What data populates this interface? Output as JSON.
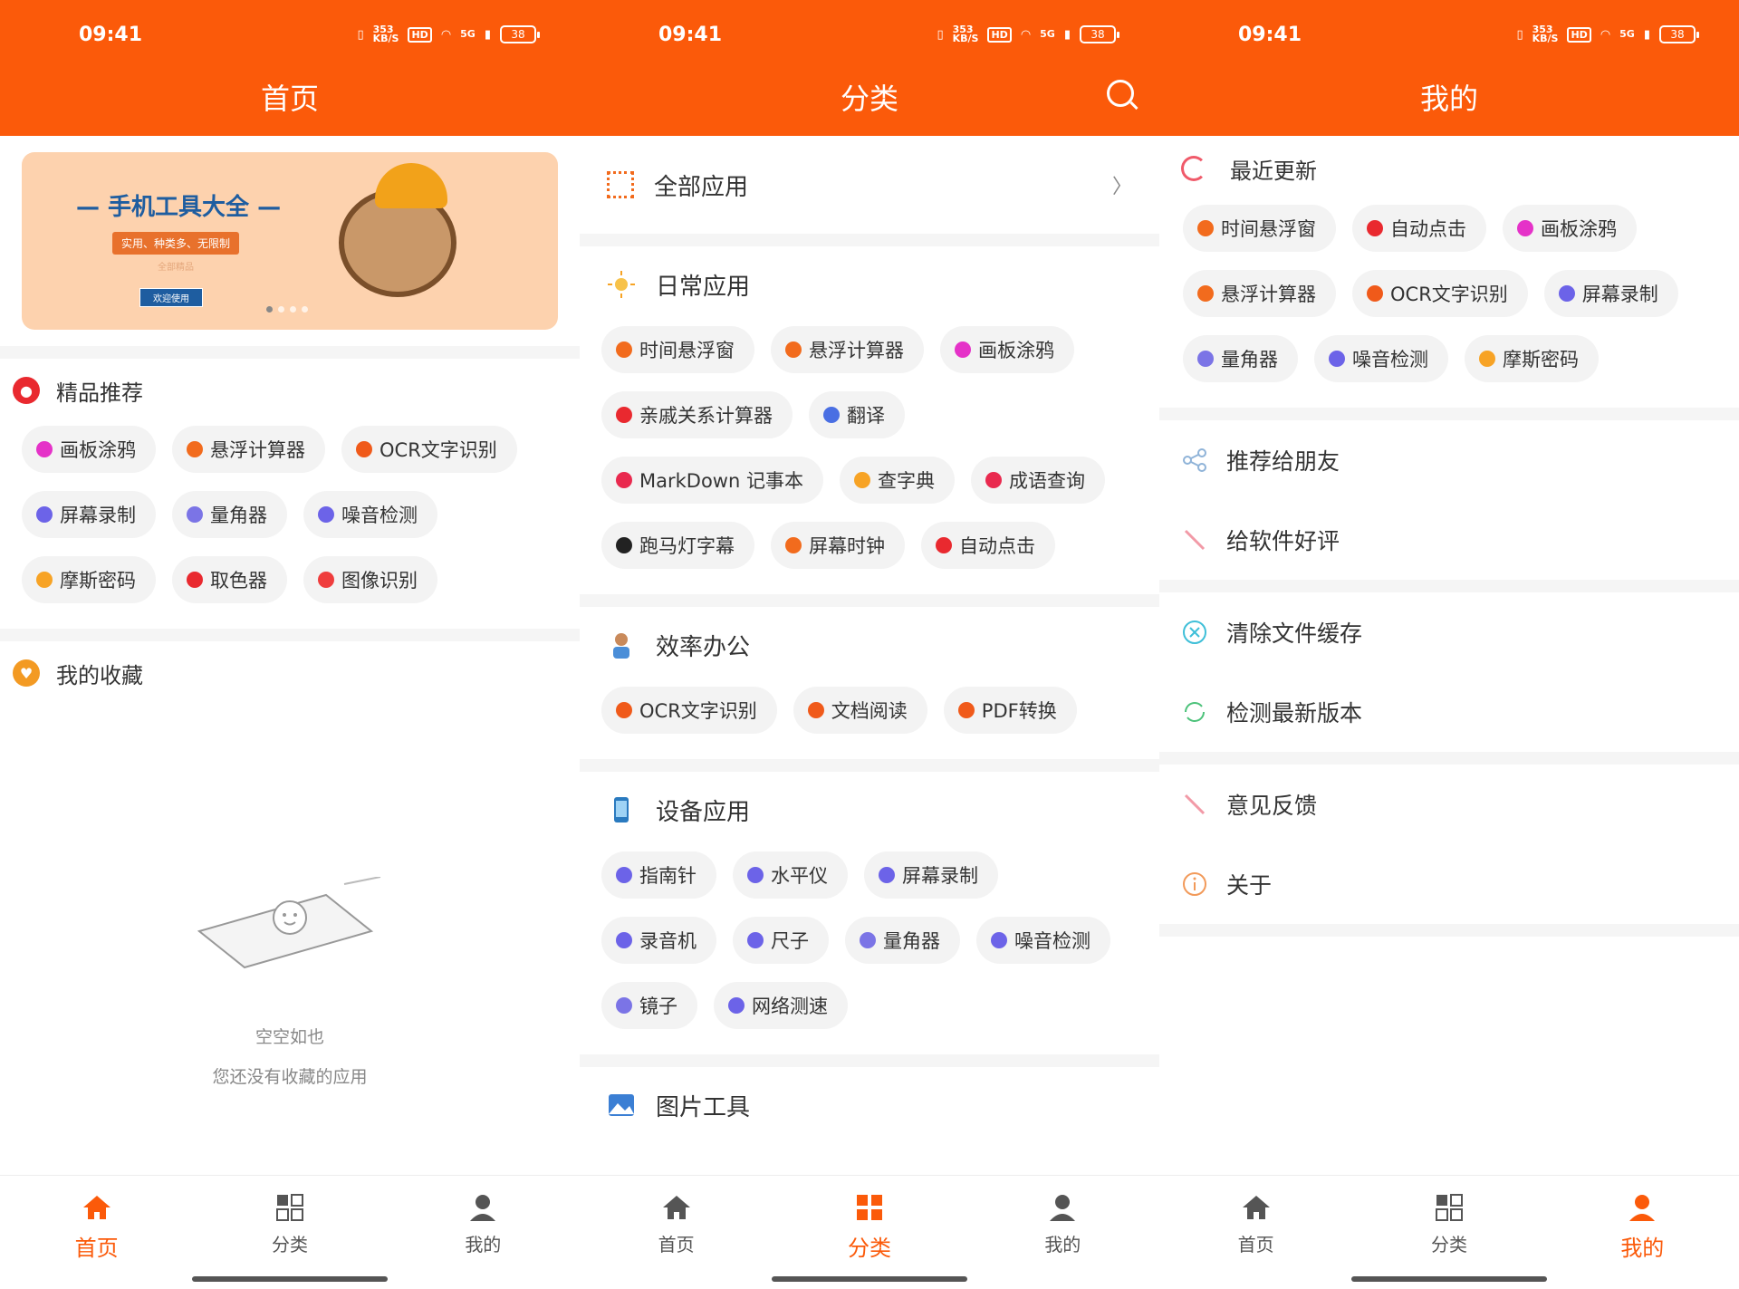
{
  "status": {
    "time": "09:41",
    "speed_top": "353",
    "speed_bottom": "KB/S",
    "hd": "HD",
    "net": "5G",
    "battery": "38"
  },
  "home": {
    "title": "首页",
    "banner": {
      "title": "— 手机工具大全 —",
      "slogan": "实用、种类多、无限制",
      "sub": "全部精品",
      "button": "欢迎使用"
    },
    "featured_title": "精品推荐",
    "featured": [
      {
        "label": "画板涂鸦",
        "color": "#e532c8"
      },
      {
        "label": "悬浮计算器",
        "color": "#f26b1d"
      },
      {
        "label": "OCR文字识别",
        "color": "#f05a1a"
      },
      {
        "label": "屏幕录制",
        "color": "#6c63e8"
      },
      {
        "label": "量角器",
        "color": "#7b74e6"
      },
      {
        "label": "噪音检测",
        "color": "#6c63e8"
      },
      {
        "label": "摩斯密码",
        "color": "#f7a325"
      },
      {
        "label": "取色器",
        "color": "#e9292f"
      },
      {
        "label": "图像识别",
        "color": "#ef3d3d"
      }
    ],
    "favorites_title": "我的收藏",
    "empty_title": "空空如也",
    "empty_desc": "您还没有收藏的应用"
  },
  "category": {
    "title": "分类",
    "all_apps": "全部应用",
    "chevron": "〉",
    "sections": [
      {
        "title": "日常应用",
        "items": [
          {
            "label": "时间悬浮窗",
            "color": "#f26b1d"
          },
          {
            "label": "悬浮计算器",
            "color": "#f26b1d"
          },
          {
            "label": "画板涂鸦",
            "color": "#e532c8"
          },
          {
            "label": "亲戚关系计算器",
            "color": "#e9292f"
          },
          {
            "label": "翻译",
            "color": "#4a6fe3"
          },
          {
            "label": "MarkDown 记事本",
            "color": "#e9294e"
          },
          {
            "label": "查字典",
            "color": "#f7a325"
          },
          {
            "label": "成语查询",
            "color": "#e9294e"
          },
          {
            "label": "跑马灯字幕",
            "color": "#222222"
          },
          {
            "label": "屏幕时钟",
            "color": "#f26b1d"
          },
          {
            "label": "自动点击",
            "color": "#e9292f"
          }
        ]
      },
      {
        "title": "效率办公",
        "items": [
          {
            "label": "OCR文字识别",
            "color": "#f05a1a"
          },
          {
            "label": "文档阅读",
            "color": "#f05a1a"
          },
          {
            "label": "PDF转换",
            "color": "#f05a1a"
          }
        ]
      },
      {
        "title": "设备应用",
        "items": [
          {
            "label": "指南针",
            "color": "#6c63e8"
          },
          {
            "label": "水平仪",
            "color": "#6c63e8"
          },
          {
            "label": "屏幕录制",
            "color": "#6c63e8"
          },
          {
            "label": "录音机",
            "color": "#6c63e8"
          },
          {
            "label": "尺子",
            "color": "#6c63e8"
          },
          {
            "label": "量角器",
            "color": "#7b74e6"
          },
          {
            "label": "噪音检测",
            "color": "#6c63e8"
          },
          {
            "label": "镜子",
            "color": "#7b74e6"
          },
          {
            "label": "网络测速",
            "color": "#6c63e8"
          }
        ]
      },
      {
        "title": "图片工具",
        "items": []
      }
    ]
  },
  "mine": {
    "title": "我的",
    "recent_title": "最近更新",
    "recent": [
      {
        "label": "时间悬浮窗",
        "color": "#f26b1d"
      },
      {
        "label": "自动点击",
        "color": "#e9292f"
      },
      {
        "label": "画板涂鸦",
        "color": "#e532c8"
      },
      {
        "label": "悬浮计算器",
        "color": "#f26b1d"
      },
      {
        "label": "OCR文字识别",
        "color": "#f05a1a"
      },
      {
        "label": "屏幕录制",
        "color": "#6c63e8"
      },
      {
        "label": "量角器",
        "color": "#7b74e6"
      },
      {
        "label": "噪音检测",
        "color": "#6c63e8"
      },
      {
        "label": "摩斯密码",
        "color": "#f7a325"
      }
    ],
    "recommend": "推荐给朋友",
    "rate": "给软件好评",
    "clear_cache": "清除文件缓存",
    "check_update": "检测最新版本",
    "feedback": "意见反馈",
    "about": "关于"
  },
  "tabs": {
    "home": "首页",
    "category": "分类",
    "mine": "我的"
  },
  "colors": {
    "accent": "#fb5a0a",
    "chip_bg": "#f3f3f3",
    "divider": "#f5f5f5"
  }
}
